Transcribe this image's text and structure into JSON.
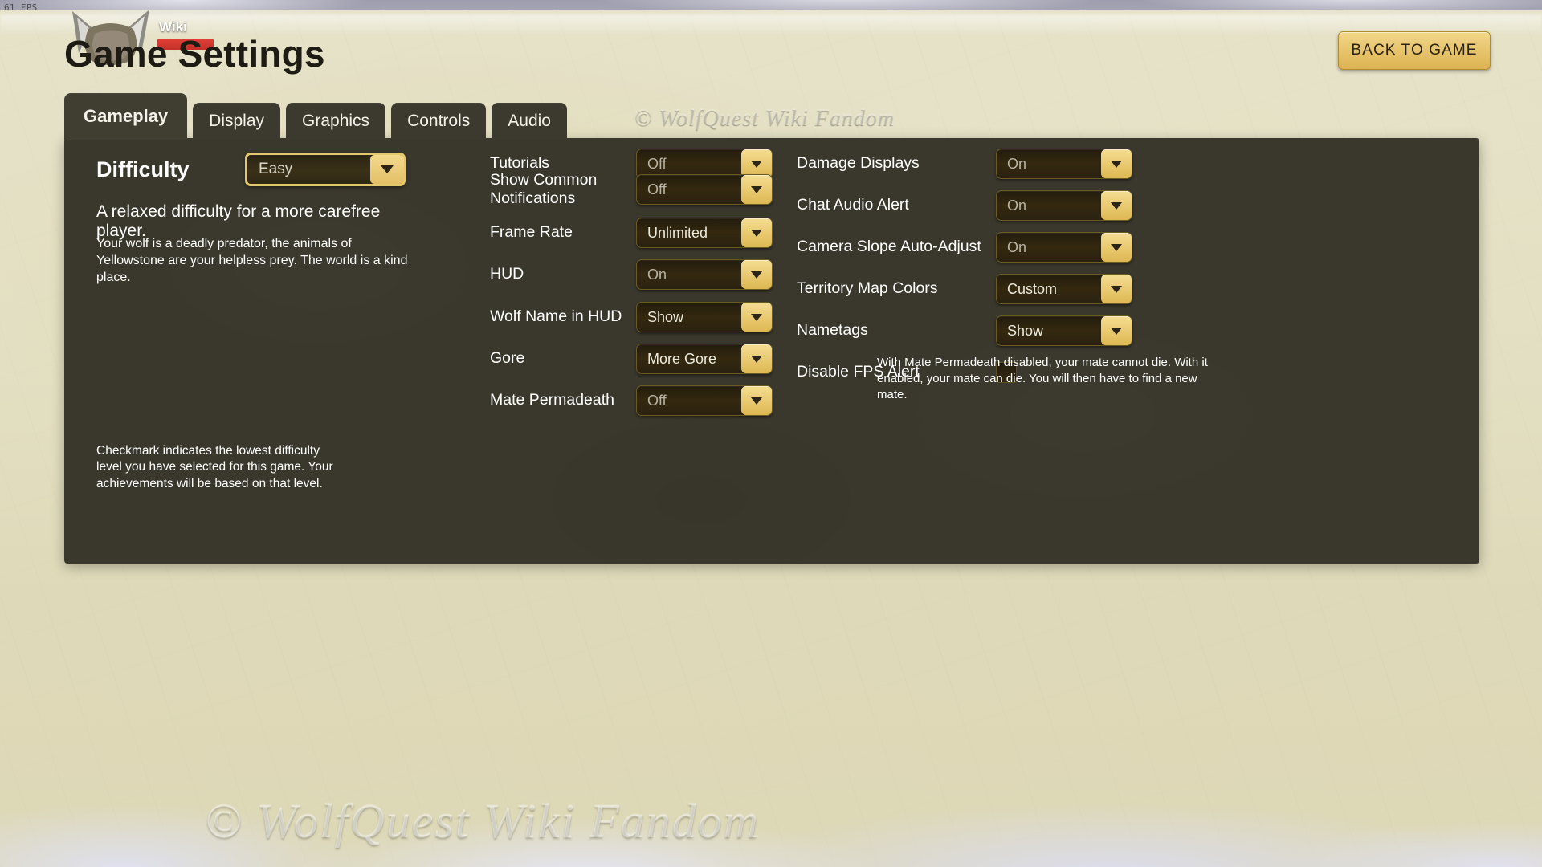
{
  "hud": {
    "fps": "61 FPS",
    "wiki_tag": "Wiki"
  },
  "header": {
    "title": "Game Settings",
    "back_button": "BACK TO GAME"
  },
  "tabs": [
    {
      "label": "Gameplay",
      "active": true
    },
    {
      "label": "Display",
      "active": false
    },
    {
      "label": "Graphics",
      "active": false
    },
    {
      "label": "Controls",
      "active": false
    },
    {
      "label": "Audio",
      "active": false
    }
  ],
  "difficulty": {
    "label": "Difficulty",
    "value": "Easy",
    "summary": "A relaxed difficulty for a more carefree player.",
    "body": "Your wolf is a deadly predator, the animals of Yellowstone are your helpless prey. The world is a kind place.",
    "note": "Checkmark indicates the lowest difficulty level you have selected for this game. Your achievements will be based on that level."
  },
  "middle_column": [
    {
      "label": "Tutorials",
      "value": "Off",
      "type": "dropdown",
      "bright": false
    },
    {
      "label": "Show Common Notifications",
      "value": "Off",
      "type": "dropdown",
      "bright": false
    },
    {
      "label": "Frame Rate",
      "value": "Unlimited",
      "type": "dropdown",
      "bright": true
    },
    {
      "label": "HUD",
      "value": "On",
      "type": "dropdown",
      "bright": false
    },
    {
      "label": "Wolf Name in HUD",
      "value": "Show",
      "type": "dropdown",
      "bright": true
    },
    {
      "label": "Gore",
      "value": "More Gore",
      "type": "dropdown",
      "bright": true
    },
    {
      "label": "Mate Permadeath",
      "value": "Off",
      "type": "dropdown",
      "bright": false
    }
  ],
  "right_column": [
    {
      "label": "Damage Displays",
      "value": "On",
      "type": "dropdown",
      "bright": false
    },
    {
      "label": "Chat Audio Alert",
      "value": "On",
      "type": "dropdown",
      "bright": false
    },
    {
      "label": "Camera Slope Auto-Adjust",
      "value": "On",
      "type": "dropdown",
      "bright": false
    },
    {
      "label": "Territory Map Colors",
      "value": "Custom",
      "type": "dropdown",
      "bright": true
    },
    {
      "label": "Nametags",
      "value": "Show",
      "type": "dropdown",
      "bright": true
    },
    {
      "label": "Disable FPS Alert",
      "value": "",
      "type": "checkbox",
      "checked": false
    }
  ],
  "permadeath_help": "With Mate Permadeath disabled, your mate cannot die. With it enabled, your mate can die. You will then have to find a new mate.",
  "watermarks": {
    "tabs": "© WolfQuest Wiki Fandom",
    "bottom": "© WolfQuest Wiki Fandom"
  },
  "colors": {
    "gold": "#e9c96f",
    "panel": "#3a382c",
    "tab_active": "#403e31",
    "dropdown_body": "#2a2110",
    "text": "#ffffff"
  }
}
